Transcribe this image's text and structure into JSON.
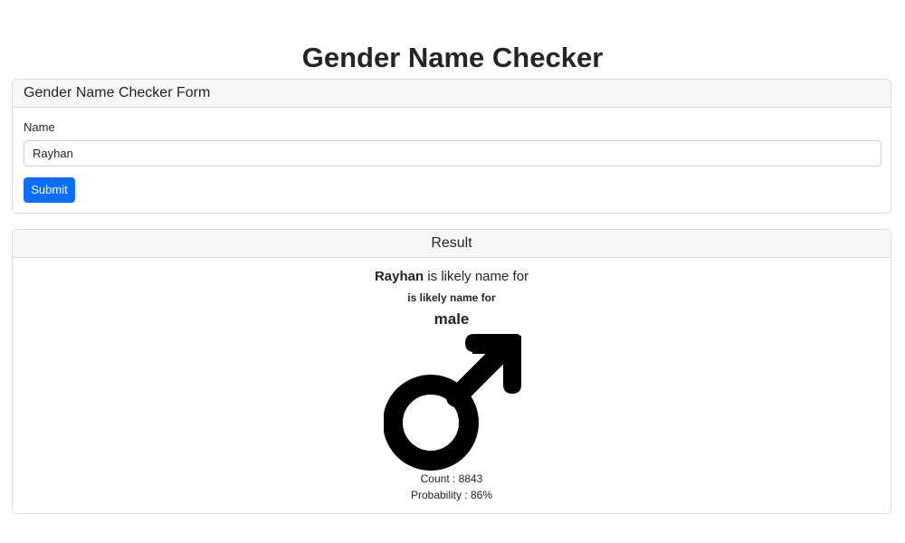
{
  "page": {
    "title": "Gender Name Checker"
  },
  "form": {
    "header": "Gender Name Checker Form",
    "name_label": "Name",
    "name_value": "Rayhan",
    "submit_label": "Submit"
  },
  "result": {
    "header": "Result",
    "name": "Rayhan",
    "phrase": " is likely name for",
    "subphrase": "is likely name for",
    "gender": "male",
    "gender_icon": "male-symbol-icon",
    "count_text": "Count : 8843",
    "probability_text": "Probability : 86%"
  },
  "colors": {
    "primary": "#0d6efd",
    "header_bg": "#f7f7f7",
    "border": "#dcdfe2",
    "text": "#212529"
  }
}
